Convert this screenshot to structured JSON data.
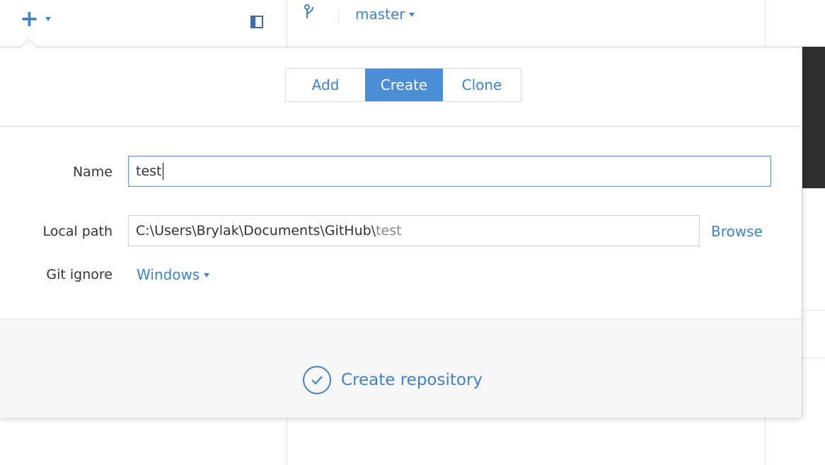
{
  "toolbar": {
    "add_icon": "plus-icon",
    "sidebar_toggle_icon": "sidebar-toggle-icon",
    "branch_icon": "branch-icon",
    "branch_name": "master"
  },
  "tabs": [
    {
      "label": "Add",
      "active": false
    },
    {
      "label": "Create",
      "active": true
    },
    {
      "label": "Clone",
      "active": false
    }
  ],
  "form": {
    "name_label": "Name",
    "name_value": "test",
    "local_path_label": "Local path",
    "local_path_prefix": "C:\\Users\\Brylak\\Documents\\GitHub\\",
    "local_path_suffix": "test",
    "browse_label": "Browse",
    "git_ignore_label": "Git ignore",
    "git_ignore_value": "Windows"
  },
  "footer": {
    "create_label": "Create repository",
    "create_icon": "check-circle-icon"
  },
  "colors": {
    "accent": "#4183c4",
    "active_tab": "#4a8fd6",
    "background_dark": "#2f2f2f"
  }
}
